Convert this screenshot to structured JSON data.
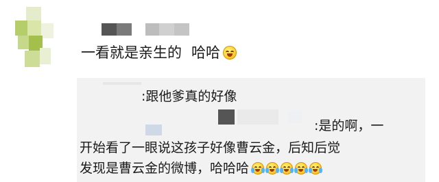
{
  "comment": {
    "text": "一看就是亲生的",
    "laugh": "哈哈",
    "emoji": "grin-emoji"
  },
  "replies": [
    {
      "text": ":跟他爹真的好像"
    },
    {
      "text_line1": ":是的啊，一",
      "text_line2": "开始看了一眼说这孩子好像曹云金，后知后觉",
      "text_line3": "发现是曹云金的微博，哈哈哈",
      "emoji": "crying-laughing-emoji",
      "emoji_count": 5
    }
  ],
  "colors": {
    "background": "#ffffff",
    "reply_background": "#f2f2f2",
    "text": "#1a1a1a",
    "avatar_green": "#a8c254",
    "avatar_light": "#d7e3a6"
  }
}
